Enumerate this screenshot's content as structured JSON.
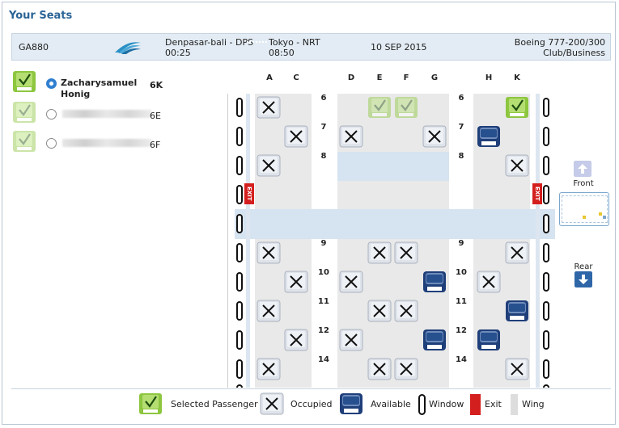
{
  "page": {
    "title": "Your Seats"
  },
  "flight": {
    "number": "GA880",
    "origin": "Denpasar-bali - DPS",
    "depart_time": "00:25",
    "destination": "Tokyo - NRT",
    "arrive_time": "08:50",
    "date": "10 SEP 2015",
    "aircraft": "Boeing 777-200/300",
    "cabin_class": "Club/Business"
  },
  "passengers": [
    {
      "name": "Zacharysamuel Honig",
      "seat": "6K",
      "selected": true
    },
    {
      "name": "",
      "seat": "6E",
      "selected": false
    },
    {
      "name": "",
      "seat": "6F",
      "selected": false
    }
  ],
  "columns": [
    "A",
    "C",
    "D",
    "E",
    "F",
    "G",
    "H",
    "K"
  ],
  "rows": [
    "6",
    "7",
    "8",
    "9",
    "10",
    "11",
    "12",
    "14"
  ],
  "exit_label": "EXIT",
  "nav": {
    "front_label": "Front",
    "rear_label": "Rear"
  },
  "legend": {
    "selected": "Selected Passenger",
    "occupied": "Occupied",
    "available": "Available",
    "window": "Window",
    "exit": "Exit",
    "wing": "Wing"
  },
  "colors": {
    "title": "#2a6496",
    "available": "#1f3f7a",
    "selected": "#8dc63f",
    "exit": "#d41f1f",
    "wing": "#d6e3f0"
  }
}
